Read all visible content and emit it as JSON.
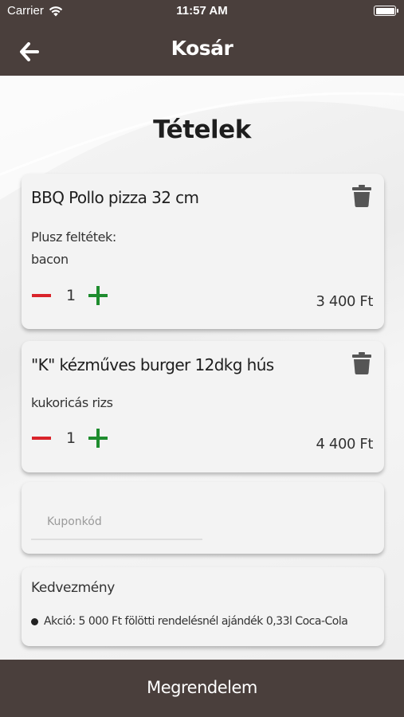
{
  "status_bar": {
    "carrier": "Carrier",
    "time": "11:57 AM"
  },
  "nav": {
    "title": "Kosár"
  },
  "page": {
    "heading": "Tételek"
  },
  "cart_items": [
    {
      "name": "BBQ Pollo pizza 32 cm",
      "extras_label": "Plusz feltétek:",
      "extras": "bacon",
      "quantity": "1",
      "price": "3 400 Ft"
    },
    {
      "name": "\"K\" kézműves burger 12dkg hús",
      "extras": "kukoricás rizs",
      "quantity": "1",
      "price": "4 400 Ft"
    }
  ],
  "coupon": {
    "placeholder": "Kuponkód"
  },
  "discount": {
    "title": "Kedvezmény",
    "items": [
      "Akció: 5 000 Ft fölötti rendelésnél ajándék 0,33l Coca-Cola"
    ]
  },
  "footer": {
    "order_label": "Megrendelem"
  },
  "colors": {
    "bar": "#4a3f3c",
    "minus": "#d9232a",
    "plus": "#1e8c2e",
    "background": "#f2f2f2"
  },
  "icons": [
    "wifi-icon",
    "battery-icon",
    "back-arrow-icon",
    "trash-icon",
    "minus-icon",
    "plus-icon"
  ]
}
